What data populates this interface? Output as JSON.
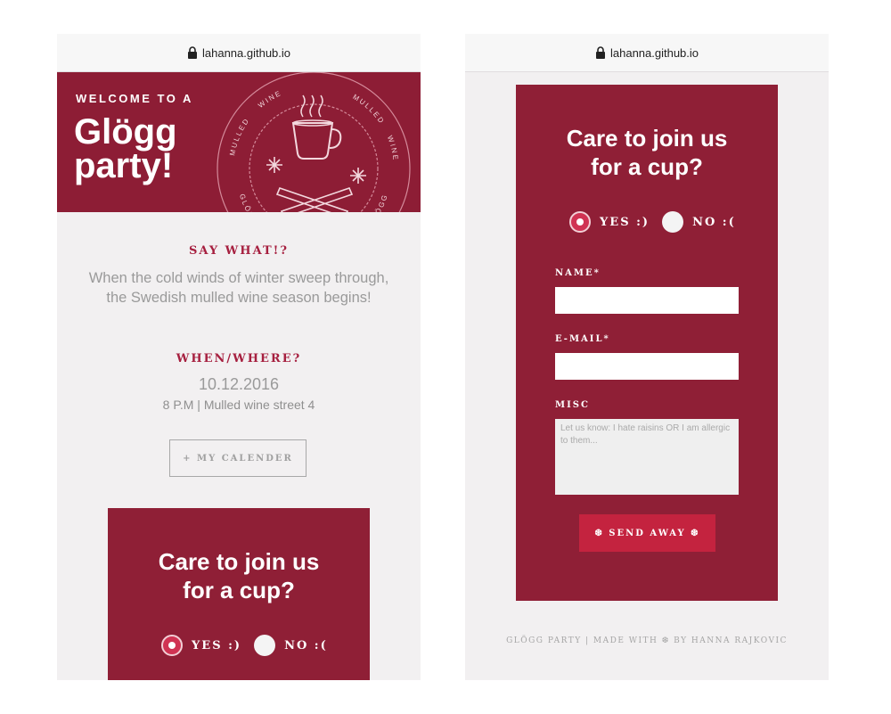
{
  "browser": {
    "url": "lahanna.github.io"
  },
  "hero": {
    "welcome": "WELCOME TO A",
    "title_line1": "Glögg",
    "title_line2": "party!",
    "badge_words": [
      "MULLED",
      "WINE",
      "MULLED",
      "WINE",
      "GLÖGG",
      "GLÖGG"
    ]
  },
  "about": {
    "heading": "SAY WHAT!?",
    "text": "When the cold winds of winter sweep through, the Swedish mulled wine season begins!"
  },
  "event": {
    "heading": "WHEN/WHERE?",
    "date": "10.12.2016",
    "place": "8 P.M | Mulled wine street 4",
    "calendar_button": "+ MY CALENDER"
  },
  "rsvp": {
    "title": "Care to join us for a cup?",
    "yes_label": "YES :)",
    "no_label": "NO :(",
    "selected": "yes",
    "name_label": "NAME*",
    "email_label": "E-MAIL*",
    "misc_label": "MISC",
    "misc_placeholder": "Let us know: I hate raisins OR I am allergic to them...",
    "send_button": "❆ SEND AWAY ❆"
  },
  "footer": {
    "text": "GLÖGG PARTY | MADE WITH ❆ BY HANNA RAJKOVIC"
  },
  "colors": {
    "brand": "#8f1f36",
    "accent": "#c4233f",
    "background": "#f2f0f1"
  }
}
